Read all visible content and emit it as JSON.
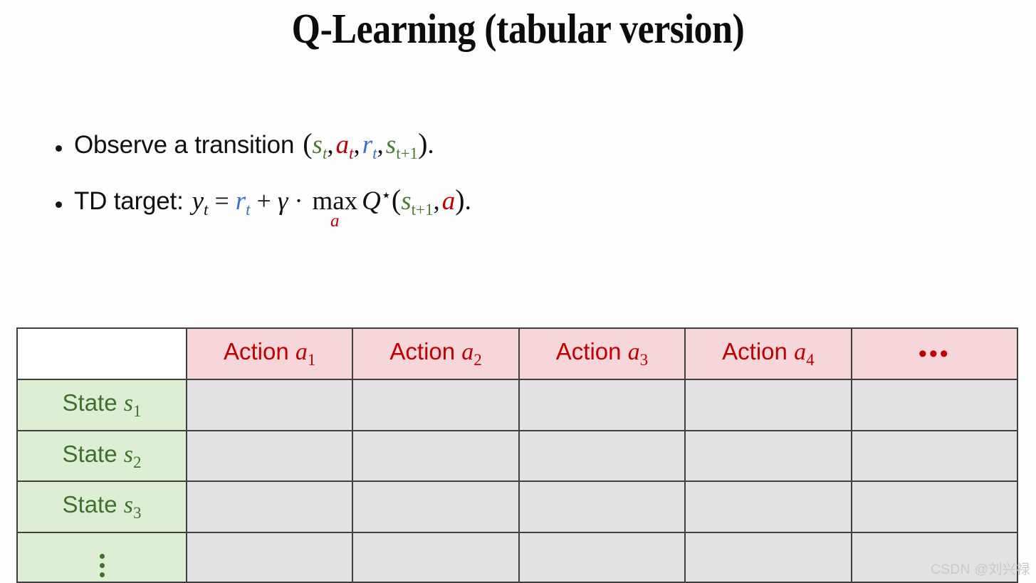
{
  "slide": {
    "title": "Q-Learning (tabular version)",
    "background_color": "#fdfdfd"
  },
  "colors": {
    "state_green": "#4c7a34",
    "action_red": "#c00000",
    "reward_blue": "#3b72c0",
    "header_fill": "#f7d6da",
    "state_fill": "#deeed5",
    "body_fill": "#e3e1e4",
    "border": "#3d403d"
  },
  "bullets": [
    {
      "lead": "Observe a transition",
      "formula_plain": "(s_t, a_t, r_t, s_{t+1}).",
      "symbols": [
        {
          "base": "s",
          "sub": "t",
          "color": "green"
        },
        {
          "base": "a",
          "sub": "t",
          "color": "red"
        },
        {
          "base": "r",
          "sub": "t",
          "color": "blue"
        },
        {
          "base": "s",
          "sub": "t+1",
          "color": "green"
        }
      ]
    },
    {
      "lead": "TD target:",
      "formula_plain": "y_t = r_t + γ · max_a Q★(s_{t+1}, a).",
      "parts": {
        "y": "y",
        "y_sub": "t",
        "equals": "=",
        "r": "r",
        "r_sub": "t",
        "plus": "+",
        "gamma": "γ",
        "cdot": "·",
        "max": "max",
        "max_sub": "a",
        "Q": "Q",
        "star": "⋆",
        "s": "s",
        "s_sub": "t+1",
        "a": "a",
        "period": "."
      }
    }
  ],
  "table": {
    "corner_label": "",
    "headers": [
      {
        "label": "Action",
        "symbol": "a",
        "sub": "1"
      },
      {
        "label": "Action",
        "symbol": "a",
        "sub": "2"
      },
      {
        "label": "Action",
        "symbol": "a",
        "sub": "3"
      },
      {
        "label": "Action",
        "symbol": "a",
        "sub": "4"
      },
      {
        "label": "",
        "symbol": "",
        "sub": "",
        "ellipsis": "•••"
      }
    ],
    "rows": [
      {
        "label": "State",
        "symbol": "s",
        "sub": "1",
        "cells": [
          "",
          "",
          "",
          "",
          ""
        ]
      },
      {
        "label": "State",
        "symbol": "s",
        "sub": "2",
        "cells": [
          "",
          "",
          "",
          "",
          ""
        ]
      },
      {
        "label": "State",
        "symbol": "s",
        "sub": "3",
        "cells": [
          "",
          "",
          "",
          "",
          ""
        ]
      },
      {
        "label": "",
        "symbol": "",
        "sub": "",
        "vertical_ellipsis": true,
        "cells": [
          "",
          "",
          "",
          "",
          ""
        ]
      }
    ]
  },
  "watermark": {
    "text": "CSDN @刘兴禄"
  }
}
